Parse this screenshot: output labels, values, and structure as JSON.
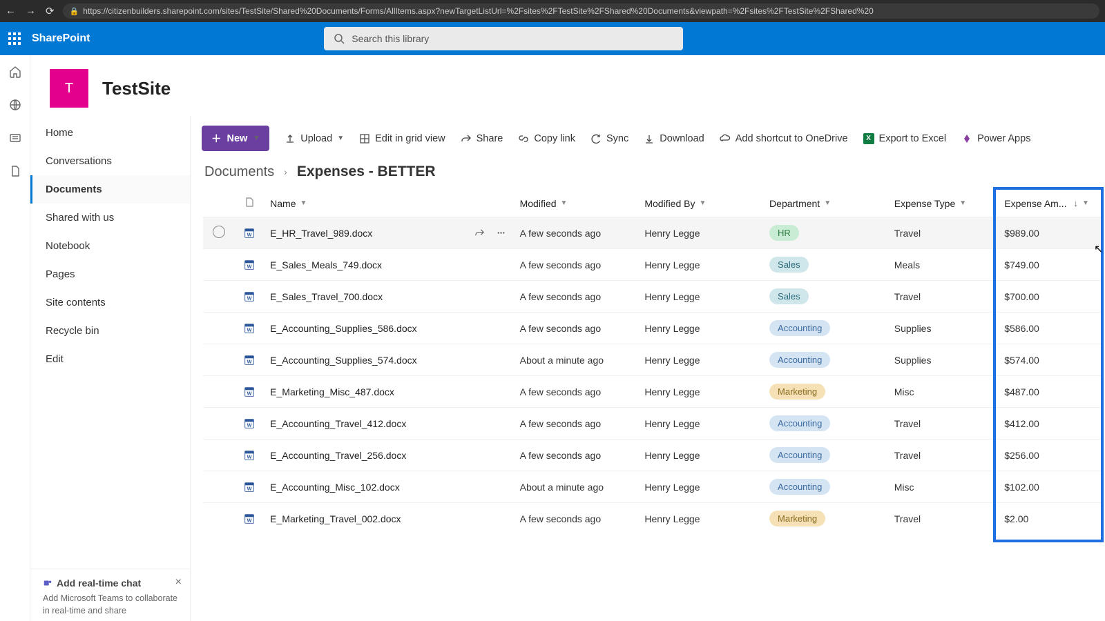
{
  "browser": {
    "url": "https://citizenbuilders.sharepoint.com/sites/TestSite/Shared%20Documents/Forms/AllItems.aspx?newTargetListUrl=%2Fsites%2FTestSite%2FShared%20Documents&viewpath=%2Fsites%2FTestSite%2FShared%20"
  },
  "suite": {
    "product": "SharePoint",
    "search_placeholder": "Search this library"
  },
  "site": {
    "logo_letter": "T",
    "title": "TestSite"
  },
  "leftnav": {
    "items": [
      {
        "label": "Home"
      },
      {
        "label": "Conversations"
      },
      {
        "label": "Documents",
        "active": true
      },
      {
        "label": "Shared with us"
      },
      {
        "label": "Notebook"
      },
      {
        "label": "Pages"
      },
      {
        "label": "Site contents"
      },
      {
        "label": "Recycle bin"
      },
      {
        "label": "Edit"
      }
    ]
  },
  "chat_promo": {
    "title": "Add real-time chat",
    "sub": "Add Microsoft Teams to collaborate in real-time and share"
  },
  "cmdbar": {
    "new": "New",
    "upload": "Upload",
    "edit_grid": "Edit in grid view",
    "share": "Share",
    "copy_link": "Copy link",
    "sync": "Sync",
    "download": "Download",
    "shortcut": "Add shortcut to OneDrive",
    "export": "Export to Excel",
    "powerapps": "Power Apps"
  },
  "breadcrumb": {
    "root": "Documents",
    "leaf": "Expenses - BETTER"
  },
  "columns": {
    "name": "Name",
    "modified": "Modified",
    "modified_by": "Modified By",
    "department": "Department",
    "expense_type": "Expense Type",
    "expense_amount": "Expense Am..."
  },
  "rows": [
    {
      "name": "E_HR_Travel_989.docx",
      "modified": "A few seconds ago",
      "by": "Henry Legge",
      "dept": "HR",
      "type": "Travel",
      "amount": "$989.00",
      "hover": true
    },
    {
      "name": "E_Sales_Meals_749.docx",
      "modified": "A few seconds ago",
      "by": "Henry Legge",
      "dept": "Sales",
      "type": "Meals",
      "amount": "$749.00"
    },
    {
      "name": "E_Sales_Travel_700.docx",
      "modified": "A few seconds ago",
      "by": "Henry Legge",
      "dept": "Sales",
      "type": "Travel",
      "amount": "$700.00"
    },
    {
      "name": "E_Accounting_Supplies_586.docx",
      "modified": "A few seconds ago",
      "by": "Henry Legge",
      "dept": "Accounting",
      "type": "Supplies",
      "amount": "$586.00"
    },
    {
      "name": "E_Accounting_Supplies_574.docx",
      "modified": "About a minute ago",
      "by": "Henry Legge",
      "dept": "Accounting",
      "type": "Supplies",
      "amount": "$574.00"
    },
    {
      "name": "E_Marketing_Misc_487.docx",
      "modified": "A few seconds ago",
      "by": "Henry Legge",
      "dept": "Marketing",
      "type": "Misc",
      "amount": "$487.00"
    },
    {
      "name": "E_Accounting_Travel_412.docx",
      "modified": "A few seconds ago",
      "by": "Henry Legge",
      "dept": "Accounting",
      "type": "Travel",
      "amount": "$412.00"
    },
    {
      "name": "E_Accounting_Travel_256.docx",
      "modified": "A few seconds ago",
      "by": "Henry Legge",
      "dept": "Accounting",
      "type": "Travel",
      "amount": "$256.00"
    },
    {
      "name": "E_Accounting_Misc_102.docx",
      "modified": "About a minute ago",
      "by": "Henry Legge",
      "dept": "Accounting",
      "type": "Misc",
      "amount": "$102.00"
    },
    {
      "name": "E_Marketing_Travel_002.docx",
      "modified": "A few seconds ago",
      "by": "Henry Legge",
      "dept": "Marketing",
      "type": "Travel",
      "amount": "$2.00"
    }
  ]
}
